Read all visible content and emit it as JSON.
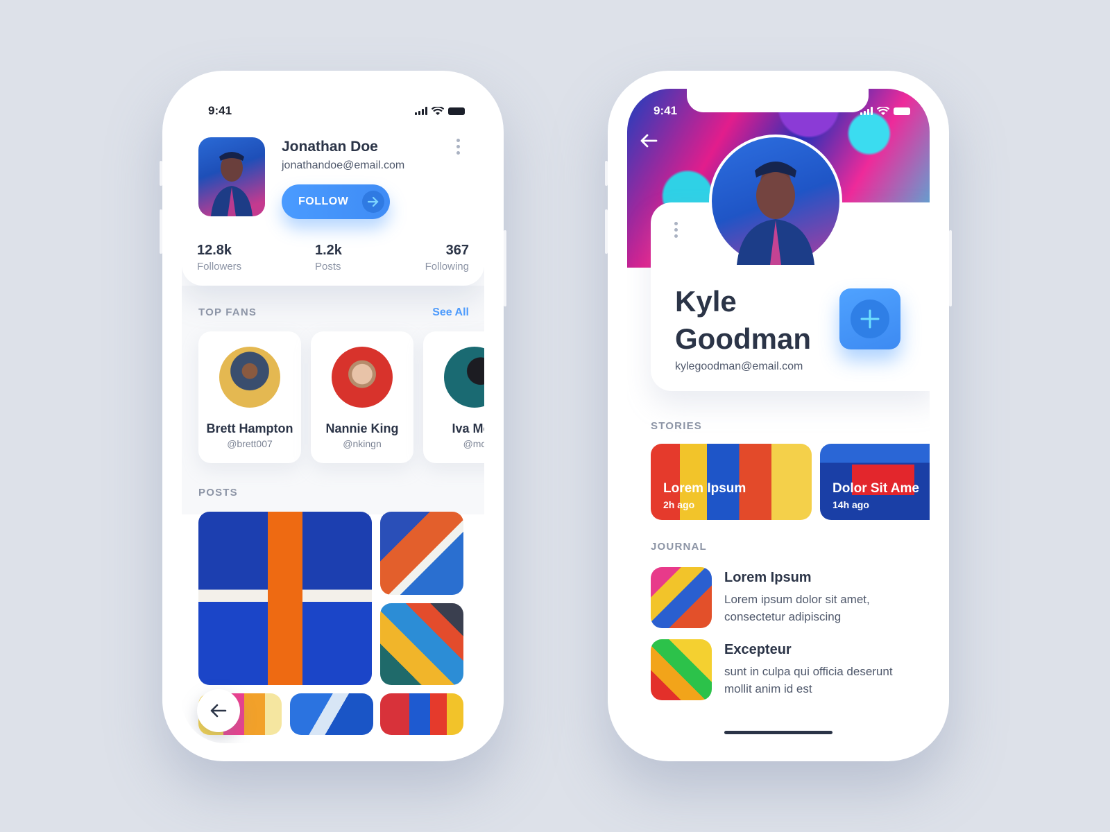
{
  "left": {
    "status": {
      "time": "9:41"
    },
    "profile": {
      "name": "Jonathan Doe",
      "email": "jonathandoe@email.com",
      "follow_label": "FOLLOW",
      "stats": [
        {
          "value": "12.8k",
          "label": "Followers"
        },
        {
          "value": "1.2k",
          "label": "Posts"
        },
        {
          "value": "367",
          "label": "Following"
        }
      ]
    },
    "top_fans": {
      "title": "TOP FANS",
      "see_all": "See All",
      "fans": [
        {
          "name": "Brett Hampton",
          "handle": "@brett007"
        },
        {
          "name": "Nannie King",
          "handle": "@nkingn"
        },
        {
          "name": "Iva Mck",
          "handle": "@mc"
        }
      ]
    },
    "posts": {
      "title": "POSTS"
    }
  },
  "right": {
    "status": {
      "time": "9:41"
    },
    "profile": {
      "name": "Kyle Goodman",
      "email": "kylegoodman@email.com"
    },
    "stories": {
      "title": "STORIES",
      "items": [
        {
          "title": "Lorem Ipsum",
          "time": "2h ago"
        },
        {
          "title": "Dolor Sit Ame",
          "time": "14h ago"
        }
      ]
    },
    "journal": {
      "title": "JOURNAL",
      "items": [
        {
          "title": "Lorem Ipsum",
          "text": "Lorem ipsum dolor sit amet, consectetur adipiscing"
        },
        {
          "title": "Excepteur",
          "text": "sunt in culpa qui officia deserunt mollit anim id est"
        }
      ]
    }
  },
  "colors": {
    "accent": "#4a9bff",
    "text": "#2b3447",
    "muted": "#8c94a5",
    "background": "#dde1e9"
  }
}
